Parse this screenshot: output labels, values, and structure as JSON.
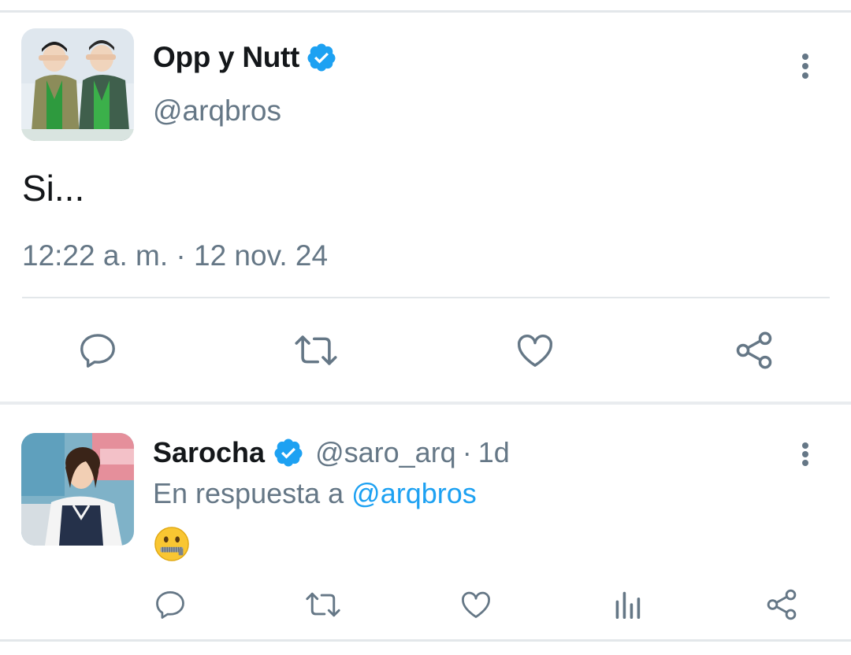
{
  "main_tweet": {
    "author_name": "Opp y Nutt",
    "author_handle": "@arqbros",
    "verified_icon": "verified-badge-icon",
    "text": "Si...",
    "timestamp": "12:22 a. m. · 12 nov. 24",
    "actions": [
      "reply-icon",
      "retweet-icon",
      "like-icon",
      "share-icon"
    ]
  },
  "reply_tweet": {
    "author_name": "Sarocha",
    "author_handle": "@saro_arq",
    "separator": "·",
    "age": "1d",
    "reply_prefix": "En respuesta a",
    "reply_mention": "@arqbros",
    "emoji": "zipper-mouth-face",
    "actions": [
      "reply-icon",
      "retweet-icon",
      "like-icon",
      "analytics-icon",
      "share-icon"
    ]
  },
  "colors": {
    "text_primary": "#14171a",
    "text_secondary": "#657786",
    "accent_blue": "#1da1f2",
    "divider": "#e3e7ea"
  }
}
